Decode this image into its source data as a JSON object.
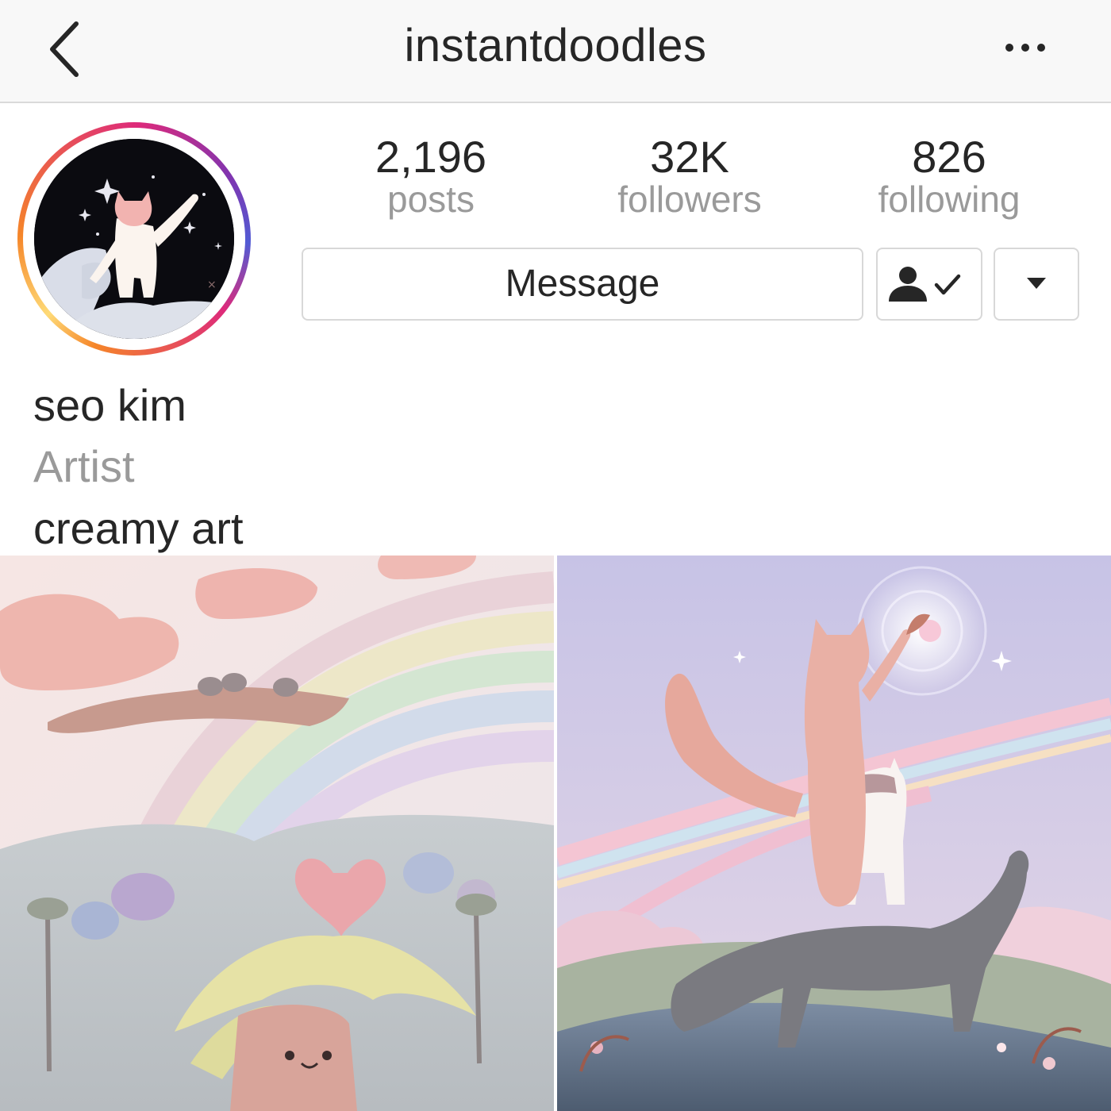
{
  "header": {
    "title": "instantdoodles"
  },
  "profile": {
    "stats": [
      {
        "value": "2,196",
        "label": "posts"
      },
      {
        "value": "32K",
        "label": "followers"
      },
      {
        "value": "826",
        "label": "following"
      }
    ],
    "message_label": "Message",
    "name": "seo kim",
    "category": "Artist",
    "bio": "creamy art"
  },
  "icons": {
    "back": "chevron-left-icon",
    "more": "more-horizontal-icon",
    "following": "person-check-icon",
    "dropdown": "caret-down-icon"
  },
  "colors": {
    "story_ring_start": "#f58529",
    "story_ring_mid": "#dd2a7b",
    "story_ring_end": "#8134af",
    "secondary_text": "#9a9a9a",
    "border": "#d8d8d8"
  }
}
